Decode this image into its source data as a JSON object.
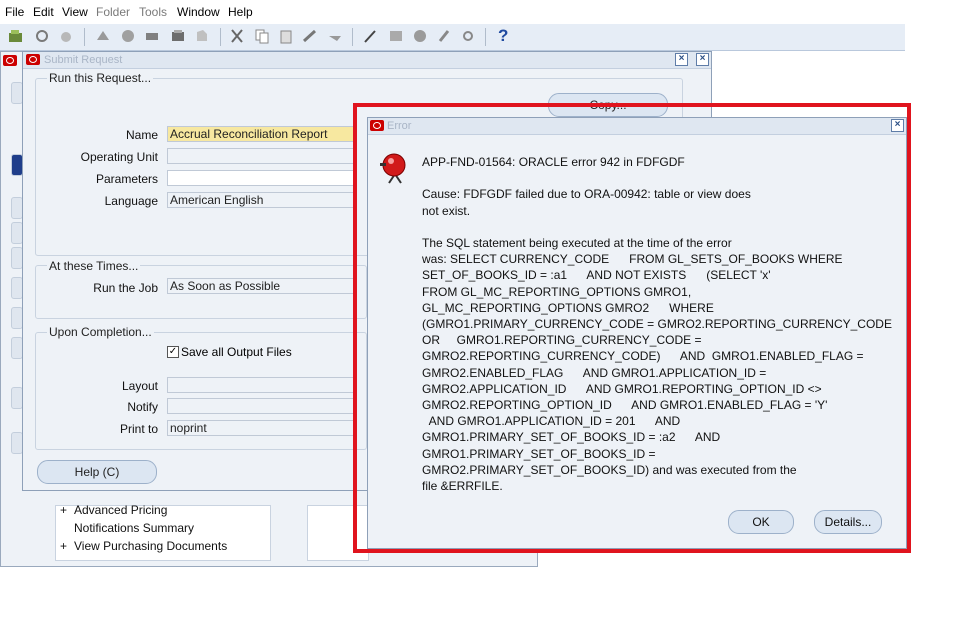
{
  "menubar": {
    "items": [
      {
        "label": "File",
        "enabled": true
      },
      {
        "label": "Edit",
        "enabled": true
      },
      {
        "label": "View",
        "enabled": true
      },
      {
        "label": "Folder",
        "enabled": false
      },
      {
        "label": "Tools",
        "enabled": false
      },
      {
        "label": "Window",
        "enabled": true
      },
      {
        "label": "Help",
        "enabled": true
      }
    ]
  },
  "toolbar": {
    "icons": [
      "new-icon",
      "open-icon",
      "save-icon",
      "next-step-icon",
      "switch-responsibility-icon",
      "print-icon",
      "close-form-icon",
      "new-record-icon",
      "find-icon",
      "show-navigator-icon",
      "cut-icon",
      "copy-icon",
      "paste-icon",
      "clear-record-icon",
      "delete-record-icon",
      "edit-field-icon",
      "zoom-icon",
      "translations-icon",
      "attachments-icon",
      "folder-tools-icon",
      "help-icon"
    ],
    "help_glyph": "?"
  },
  "submit_request": {
    "title": "Submit Request",
    "run_group_label": "Run this Request...",
    "copy_button": "Copy...",
    "name_label": "Name",
    "name_value": "Accrual Reconciliation Report",
    "operating_unit_label": "Operating Unit",
    "operating_unit_value": "",
    "parameters_label": "Parameters",
    "parameters_value": "",
    "language_label": "Language",
    "language_value": "American English",
    "times_group_label": "At these Times...",
    "run_job_label": "Run the Job",
    "run_job_value": "As Soon as Possible",
    "completion_group_label": "Upon Completion...",
    "save_output_label": "Save all Output Files",
    "save_output_checked": true,
    "layout_label": "Layout",
    "layout_value": "",
    "notify_label": "Notify",
    "notify_value": "",
    "print_to_label": "Print to",
    "print_to_value": "noprint",
    "help_button": "Help (C)"
  },
  "navigator_list": {
    "items": [
      {
        "prefix": "+",
        "label": "Advanced Pricing"
      },
      {
        "prefix": "",
        "label": "Notifications Summary"
      },
      {
        "prefix": "+",
        "label": "View Purchasing Documents"
      }
    ]
  },
  "error_dialog": {
    "title": "Error",
    "message": "APP-FND-01564: ORACLE error 942 in FDFGDF\n\nCause: FDFGDF failed due to ORA-00942: table or view does\nnot exist.\n\nThe SQL statement being executed at the time of the error\nwas: SELECT CURRENCY_CODE      FROM GL_SETS_OF_BOOKS WHERE\nSET_OF_BOOKS_ID = :a1      AND NOT EXISTS      (SELECT 'x'\nFROM GL_MC_REPORTING_OPTIONS GMRO1,\nGL_MC_REPORTING_OPTIONS GMRO2      WHERE\n(GMRO1.PRIMARY_CURRENCY_CODE = GMRO2.REPORTING_CURRENCY_CODE\nOR     GMRO1.REPORTING_CURRENCY_CODE =\nGMRO2.REPORTING_CURRENCY_CODE)      AND  GMRO1.ENABLED_FLAG =\nGMRO2.ENABLED_FLAG      AND GMRO1.APPLICATION_ID =\nGMRO2.APPLICATION_ID      AND GMRO1.REPORTING_OPTION_ID <>\nGMRO2.REPORTING_OPTION_ID      AND GMRO1.ENABLED_FLAG = 'Y'\n  AND GMRO1.APPLICATION_ID = 201      AND\nGMRO1.PRIMARY_SET_OF_BOOKS_ID = :a2      AND\nGMRO1.PRIMARY_SET_OF_BOOKS_ID =\nGMRO2.PRIMARY_SET_OF_BOOKS_ID) and was executed from the\nfile &ERRFILE.",
    "ok_button": "OK",
    "details_button": "Details..."
  },
  "colors": {
    "highlight_frame": "#e0141e",
    "oracle_red": "#cc0000",
    "window_bg": "#eef2f7",
    "toolbar_bg": "#e6edf6"
  }
}
